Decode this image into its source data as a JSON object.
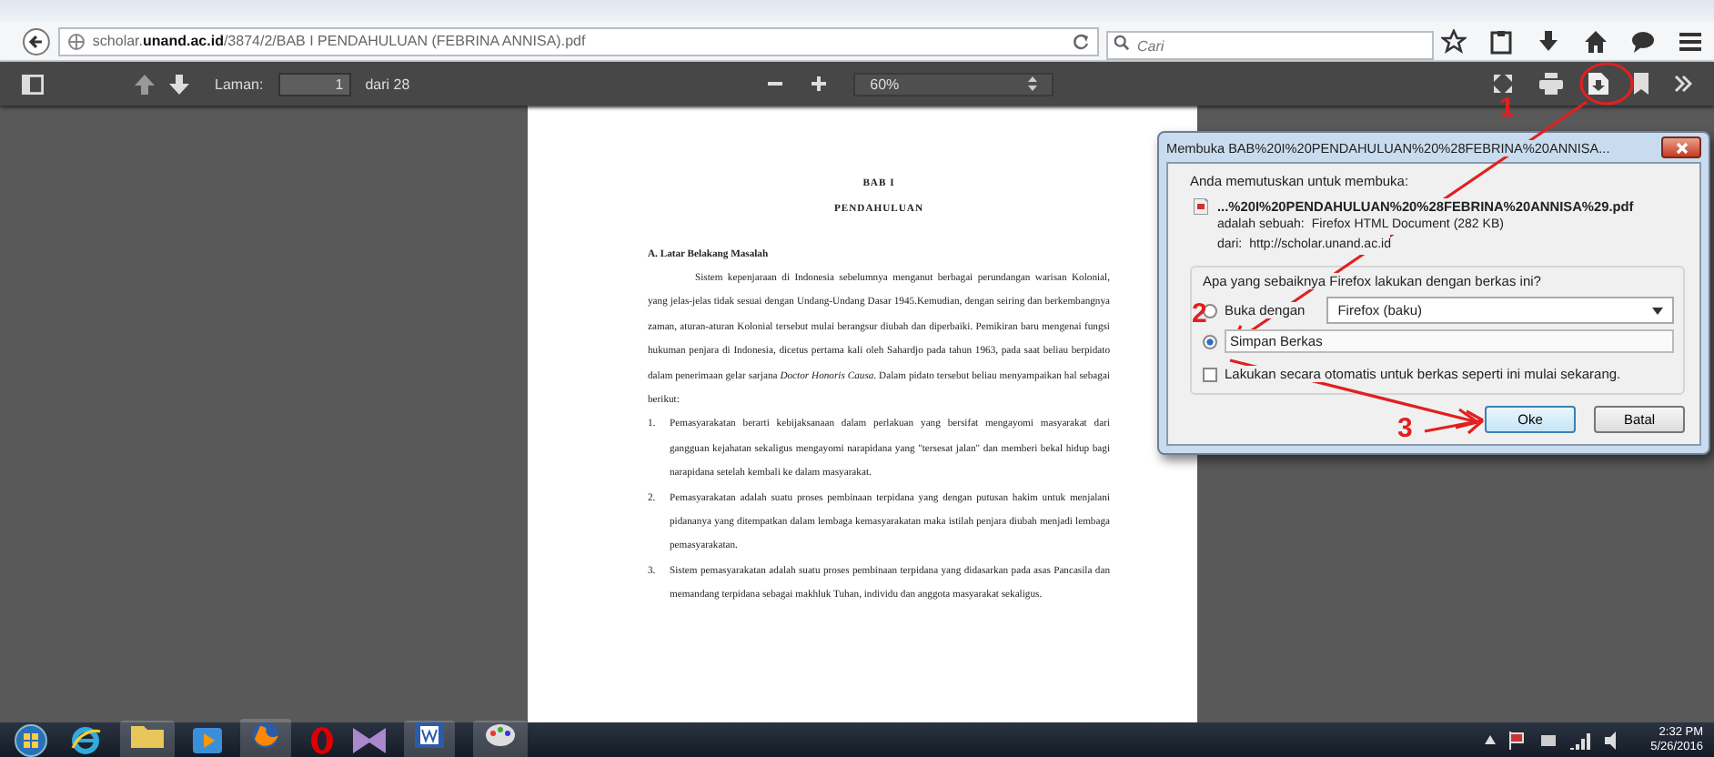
{
  "browser": {
    "url": "scholar.**unand.ac.id**/3874/2/BAB I PENDAHULUAN (FEBRINA ANNISA).pdf",
    "search_placeholder": "Cari"
  },
  "pdf_toolbar": {
    "page_label": "Laman:",
    "page_value": "1",
    "page_total": "dari 28",
    "zoom": "60%"
  },
  "document": {
    "chapter": "BAB I",
    "title": "PENDAHULUAN",
    "section": "A.  Latar Belakang Masalah",
    "paragraph": "Sistem kepenjaraan di Indonesia sebelumnya menganut berbagai perundangan warisan Kolonial, yang jelas-jelas tidak sesuai dengan Undang-Undang Dasar 1945.Kemudian, dengan seiring dan berkembangnya zaman, aturan-aturan Kolonial tersebut mulai berangsur diubah dan diperbaiki. Pemikiran baru mengenai fungsi hukuman penjara di Indonesia, dicetus pertama kali oleh Sahardjo pada tahun 1963, pada saat beliau berpidato dalam penerimaan gelar sarjana *Doctor Honoris Causa*. Dalam pidato tersebut beliau menyampaikan hal sebagai berikut:",
    "list": [
      {
        "number": "1.",
        "text": "Pemasyarakatan berarti kebijaksanaan dalam perlakuan yang bersifat mengayomi masyarakat dari gangguan kejahatan sekaligus mengayomi narapidana yang \"tersesat jalan\" dan memberi bekal hidup bagi narapidana setelah kembali ke dalam masyarakat."
      },
      {
        "number": "2.",
        "text": "Pemasyarakatan adalah suatu proses pembinaan terpidana yang dengan putusan hakim untuk menjalani pidananya yang ditempatkan dalam lembaga kemasyarakatan maka istilah penjara diubah menjadi lembaga pemasyarakatan."
      },
      {
        "number": "3.",
        "text": "Sistem pemasyarakatan adalah suatu proses pembinaan terpidana yang didasarkan pada asas Pancasila dan memandang terpidana sebagai makhluk Tuhan, individu dan anggota masyarakat sekaligus."
      }
    ]
  },
  "dialog": {
    "title": "Membuka BAB%20I%20PENDAHULUAN%20%28FEBRINA%20ANNISA...",
    "intro": "Anda memutuskan untuk membuka:",
    "file_name": "...%20I%20PENDAHULUAN%20%28FEBRINA%20ANNISA%29.pdf",
    "type_label": "adalah sebuah:",
    "type_value": "Firefox HTML Document (282 KB)",
    "from_label": "dari:",
    "from_value": "http://scholar.unand.ac.id",
    "question": "Apa yang sebaiknya Firefox lakukan dengan berkas ini?",
    "options": [
      {
        "kind": "open-with",
        "label": "Buka dengan",
        "selected": false,
        "app": "Firefox (baku)"
      },
      {
        "kind": "save",
        "label": "Simpan Berkas",
        "selected": true
      }
    ],
    "auto_checkbox": {
      "label": "Lakukan secara otomatis untuk berkas seperti ini mulai sekarang.",
      "checked": false
    },
    "buttons": [
      {
        "label": "Oke",
        "default": true
      },
      {
        "label": "Batal",
        "default": false
      }
    ]
  },
  "annotations": [
    {
      "label": "1"
    },
    {
      "label": "2"
    },
    {
      "label": "3"
    }
  ],
  "taskbar": {
    "time": "2:32 PM",
    "date": "5/26/2016"
  }
}
